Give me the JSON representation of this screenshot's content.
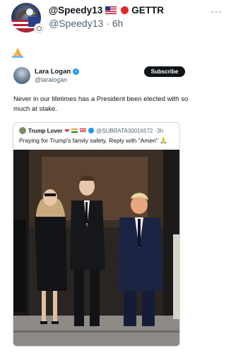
{
  "post": {
    "handle": "@Speedy13",
    "platform": "GETTR",
    "username": "@Speedy13",
    "separator": "·",
    "time": "6h",
    "more": "···",
    "body_emoji": "🙏"
  },
  "embedded_post": {
    "author_name": "Lara Logan",
    "author_handle": "@laralogan",
    "subscribe_label": "Subscribe",
    "text": "Never in our lifetimes has a President been elected with so much at stake."
  },
  "quoted_post": {
    "author_name": "Trump Lover",
    "heart": "❤",
    "handle": "@SUBRATA30016572",
    "time": "·3h",
    "text": "Praying for Trump's family safety. Reply with \"Amen\" 🙏"
  },
  "colors": {
    "verified_blue": "#1d9bf0",
    "gettr_red": "#e0252b",
    "text_primary": "#0f1419",
    "text_secondary": "#536471"
  }
}
